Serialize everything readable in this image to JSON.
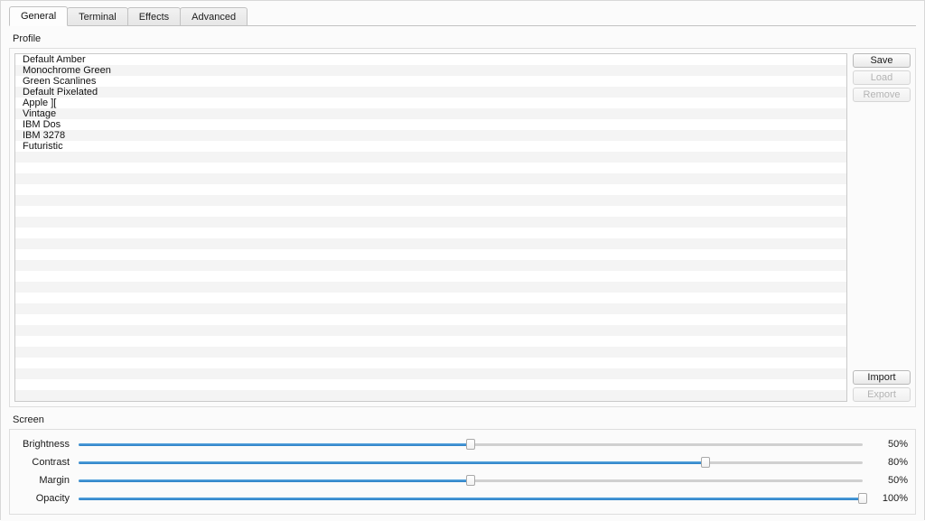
{
  "tabs": [
    {
      "label": "General",
      "active": true
    },
    {
      "label": "Terminal",
      "active": false
    },
    {
      "label": "Effects",
      "active": false
    },
    {
      "label": "Advanced",
      "active": false
    }
  ],
  "profile_group": {
    "title": "Profile",
    "items": [
      "Default Amber",
      "Monochrome Green",
      "Green Scanlines",
      "Default Pixelated",
      "Apple ][",
      "Vintage",
      "IBM Dos",
      "IBM 3278",
      "Futuristic"
    ],
    "buttons_top": [
      {
        "label": "Save",
        "enabled": true
      },
      {
        "label": "Load",
        "enabled": false
      },
      {
        "label": "Remove",
        "enabled": false
      }
    ],
    "buttons_bottom": [
      {
        "label": "Import",
        "enabled": true
      },
      {
        "label": "Export",
        "enabled": false
      }
    ]
  },
  "screen_group": {
    "title": "Screen",
    "sliders": [
      {
        "label": "Brightness",
        "value": 50,
        "value_text": "50%"
      },
      {
        "label": "Contrast",
        "value": 80,
        "value_text": "80%"
      },
      {
        "label": "Margin",
        "value": 50,
        "value_text": "50%"
      },
      {
        "label": "Opacity",
        "value": 100,
        "value_text": "100%"
      }
    ]
  },
  "colors": {
    "accent": "#2b80c6",
    "accent_light": "#57a5de",
    "groove": "#d0d0d0",
    "row_alt": "#f4f4f4",
    "window_bg": "#fbfbfb"
  }
}
